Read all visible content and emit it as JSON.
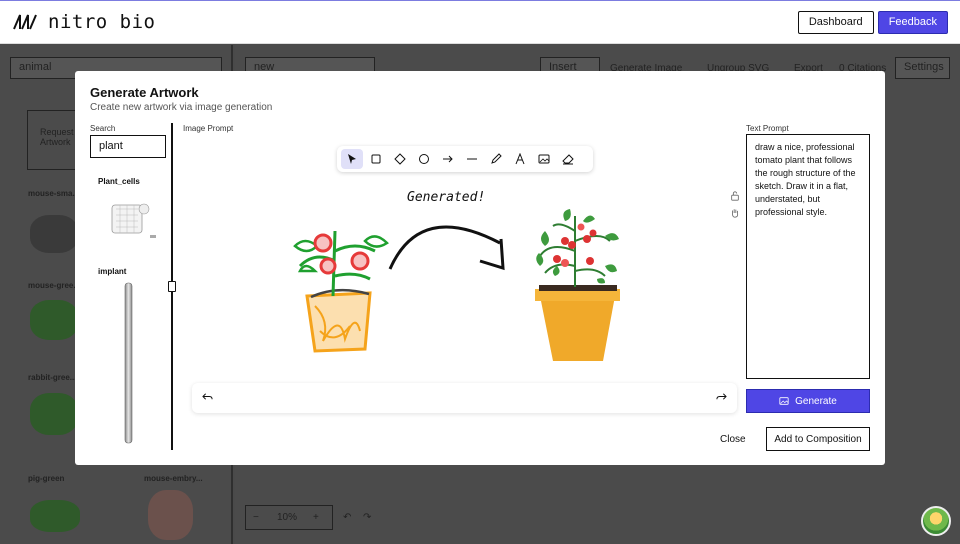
{
  "app": {
    "name": "nitro bio"
  },
  "topbar": {
    "dashboard_label": "Dashboard",
    "feedback_label": "Feedback"
  },
  "background": {
    "search_value": "animal",
    "composition_name": "new",
    "toolbar": {
      "insert_plot": "Insert Plot",
      "generate_image": "Generate Image",
      "ungroup_svg": "Ungroup SVG",
      "export": "Export",
      "citations": "0 Citations",
      "settings": "Settings"
    },
    "request_artwork": "Request Artwork",
    "items": [
      "mouse-sma...",
      "mouse-gree...",
      "rabbit-gree...",
      "pig-green",
      "mouse-embry..."
    ],
    "zoom": "10%",
    "zoom_minus": "−",
    "zoom_plus": "+"
  },
  "modal": {
    "title": "Generate Artwork",
    "subtitle": "Create new artwork via image generation",
    "search_label": "Search",
    "search_value": "plant",
    "results": [
      {
        "label": "Plant_cells"
      },
      {
        "label": "implant"
      }
    ],
    "image_prompt_label": "Image Prompt",
    "sketch_annotation": "Generated!",
    "text_prompt_label": "Text Prompt",
    "text_prompt": "draw a nice, professional tomato plant that follows the rough structure of the sketch. Draw it in a flat, understated, but professional style.",
    "generate_label": "Generate",
    "close_label": "Close",
    "add_label": "Add to Composition",
    "tools": [
      "select-icon",
      "rectangle-icon",
      "diamond-icon",
      "ellipse-icon",
      "arrow-icon",
      "line-icon",
      "pencil-icon",
      "text-icon",
      "image-icon",
      "eraser-icon"
    ]
  },
  "colors": {
    "primary": "#4f46e5",
    "backdrop": "#4b4b4b",
    "sketch_red": "#e63a3a",
    "sketch_green": "#1fa02f",
    "sketch_orange": "#f5a31b",
    "pot_orange": "#f0a92a"
  }
}
